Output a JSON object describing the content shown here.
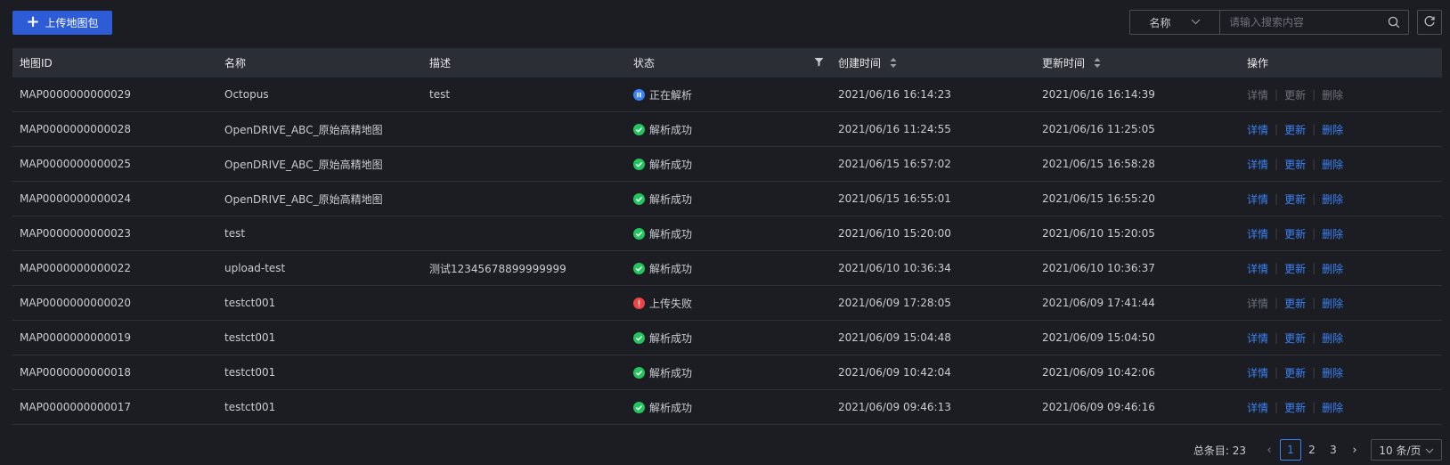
{
  "toolbar": {
    "upload_label": "上传地图包",
    "search_field": "名称",
    "search_placeholder": "请输入搜索内容"
  },
  "colors": {
    "primary": "#2e5bd6",
    "link": "#3b82f6",
    "success": "#22c55e",
    "error": "#ef4444",
    "processing": "#3b82f6"
  },
  "table": {
    "columns": [
      "地图ID",
      "名称",
      "描述",
      "状态",
      "创建时间",
      "更新时间",
      "操作"
    ],
    "actions": [
      "详情",
      "更新",
      "删除"
    ],
    "rows": [
      {
        "id": "MAP0000000000029",
        "name": "Octopus",
        "desc": "test",
        "status": "正在解析",
        "status_type": "processing",
        "created": "2021/06/16 16:14:23",
        "updated": "2021/06/16 16:14:39",
        "actions_enabled": [
          false,
          false,
          false
        ]
      },
      {
        "id": "MAP0000000000028",
        "name": "OpenDRIVE_ABC_原始高精地图",
        "desc": "",
        "status": "解析成功",
        "status_type": "success",
        "created": "2021/06/16 11:24:55",
        "updated": "2021/06/16 11:25:05",
        "actions_enabled": [
          true,
          true,
          true
        ]
      },
      {
        "id": "MAP0000000000025",
        "name": "OpenDRIVE_ABC_原始高精地图",
        "desc": "",
        "status": "解析成功",
        "status_type": "success",
        "created": "2021/06/15 16:57:02",
        "updated": "2021/06/15 16:58:28",
        "actions_enabled": [
          true,
          true,
          true
        ]
      },
      {
        "id": "MAP0000000000024",
        "name": "OpenDRIVE_ABC_原始高精地图",
        "desc": "",
        "status": "解析成功",
        "status_type": "success",
        "created": "2021/06/15 16:55:01",
        "updated": "2021/06/15 16:55:20",
        "actions_enabled": [
          true,
          true,
          true
        ]
      },
      {
        "id": "MAP0000000000023",
        "name": "test",
        "desc": "",
        "status": "解析成功",
        "status_type": "success",
        "created": "2021/06/10 15:20:00",
        "updated": "2021/06/10 15:20:05",
        "actions_enabled": [
          true,
          true,
          true
        ]
      },
      {
        "id": "MAP0000000000022",
        "name": "upload-test",
        "desc": "测试12345678899999999",
        "status": "解析成功",
        "status_type": "success",
        "created": "2021/06/10 10:36:34",
        "updated": "2021/06/10 10:36:37",
        "actions_enabled": [
          true,
          true,
          true
        ]
      },
      {
        "id": "MAP0000000000020",
        "name": "testct001",
        "desc": "",
        "status": "上传失败",
        "status_type": "error",
        "created": "2021/06/09 17:28:05",
        "updated": "2021/06/09 17:41:44",
        "actions_enabled": [
          false,
          true,
          true
        ]
      },
      {
        "id": "MAP0000000000019",
        "name": "testct001",
        "desc": "",
        "status": "解析成功",
        "status_type": "success",
        "created": "2021/06/09 15:04:48",
        "updated": "2021/06/09 15:04:50",
        "actions_enabled": [
          true,
          true,
          true
        ]
      },
      {
        "id": "MAP0000000000018",
        "name": "testct001",
        "desc": "",
        "status": "解析成功",
        "status_type": "success",
        "created": "2021/06/09 10:42:04",
        "updated": "2021/06/09 10:42:06",
        "actions_enabled": [
          true,
          true,
          true
        ]
      },
      {
        "id": "MAP0000000000017",
        "name": "testct001",
        "desc": "",
        "status": "解析成功",
        "status_type": "success",
        "created": "2021/06/09 09:46:13",
        "updated": "2021/06/09 09:46:16",
        "actions_enabled": [
          true,
          true,
          true
        ]
      }
    ]
  },
  "pagination": {
    "total_label": "总条目: 23",
    "pages": [
      "1",
      "2",
      "3"
    ],
    "current": "1",
    "page_size": "10 条/页"
  }
}
